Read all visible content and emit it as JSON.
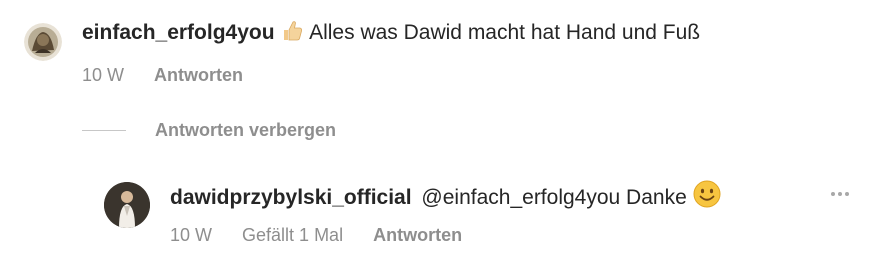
{
  "comment": {
    "username": "einfach_erfolg4you",
    "emoji": "thumbs-up",
    "text": "Alles was Dawid macht hat Hand und Fuß",
    "time": "10 W",
    "reply_label": "Antworten"
  },
  "replies_toggle": {
    "label": "Antworten verbergen"
  },
  "reply": {
    "username": "dawidprzybylski_official",
    "text": "@einfach_erfolg4you Danke",
    "emoji": "smiling-face",
    "time": "10 W",
    "likes": "Gefällt 1 Mal",
    "reply_label": "Antworten"
  },
  "colors": {
    "text": "#262626",
    "secondary": "#8e8e8e",
    "divider": "#c7c7c7"
  }
}
